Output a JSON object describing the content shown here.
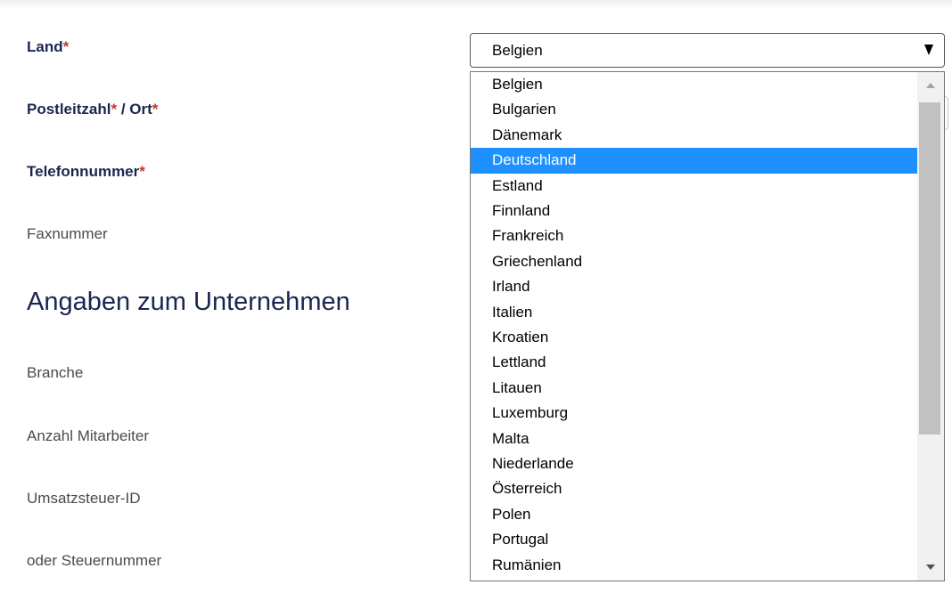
{
  "form": {
    "country": {
      "label": "Land",
      "required_mark": "*"
    },
    "postal_city": {
      "label_postal": "Postleitzahl",
      "required_mark_postal": "*",
      "separator": " / ",
      "label_city": "Ort",
      "required_mark_city": "*"
    },
    "phone": {
      "label": "Telefonnummer",
      "required_mark": "*"
    },
    "fax": {
      "label": "Faxnummer"
    }
  },
  "company_section": {
    "heading": "Angaben zum Unternehmen",
    "industry_label": "Branche",
    "employees_label": "Anzahl Mitarbeiter",
    "vat_label": "Umsatzsteuer-ID",
    "tax_number_label": "oder Steuernummer"
  },
  "country_select": {
    "selected_value": "Belgien",
    "highlighted_option": "Deutschland",
    "options": [
      "Belgien",
      "Bulgarien",
      "Dänemark",
      "Deutschland",
      "Estland",
      "Finnland",
      "Frankreich",
      "Griechenland",
      "Irland",
      "Italien",
      "Kroatien",
      "Lettland",
      "Litauen",
      "Luxemburg",
      "Malta",
      "Niederlande",
      "Österreich",
      "Polen",
      "Portugal",
      "Rumänien"
    ]
  },
  "colors": {
    "label_required": "#1b2650",
    "required_mark": "#c0392b",
    "highlight": "#1e90ff",
    "scrollbar_thumb": "#c1c1c1"
  },
  "icons": {
    "select_arrow": "chevron-down-icon",
    "scroll_up": "scroll-up-arrow-icon",
    "scroll_down": "scroll-down-arrow-icon"
  }
}
